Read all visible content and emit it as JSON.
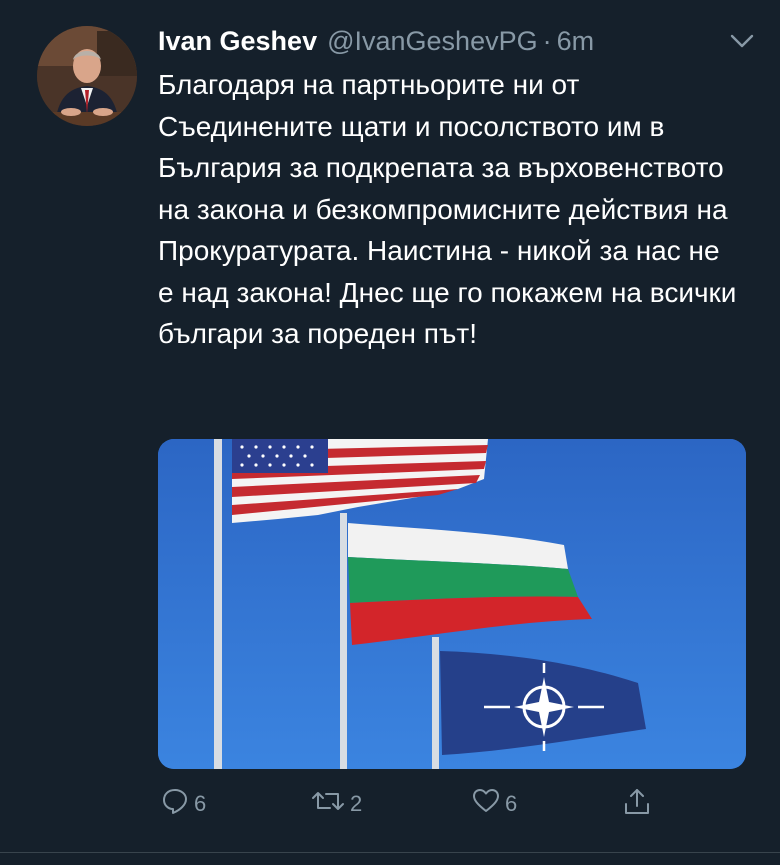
{
  "tweet": {
    "author_name": "Ivan Geshev",
    "handle": "@IvanGeshevPG",
    "separator": "·",
    "time": "6m",
    "text": "Благодаря на партньорите ни от Съединените щати и посолството им в България за подкрепата за върховенството на закона и безкомпромисните действия на Прокуратурата. Наистина - никой за нас не е над закона! Днес ще го покажем на всички българи за пореден път!",
    "media": {
      "description_icons": [
        "us-flag",
        "bulgarian-flag",
        "nato-flag"
      ]
    }
  },
  "actions": {
    "reply_count": "6",
    "retweet_count": "2",
    "like_count": "6"
  },
  "colors": {
    "background": "#15202b",
    "secondary_text": "#8899a6",
    "sky": "#2e6fd0"
  }
}
